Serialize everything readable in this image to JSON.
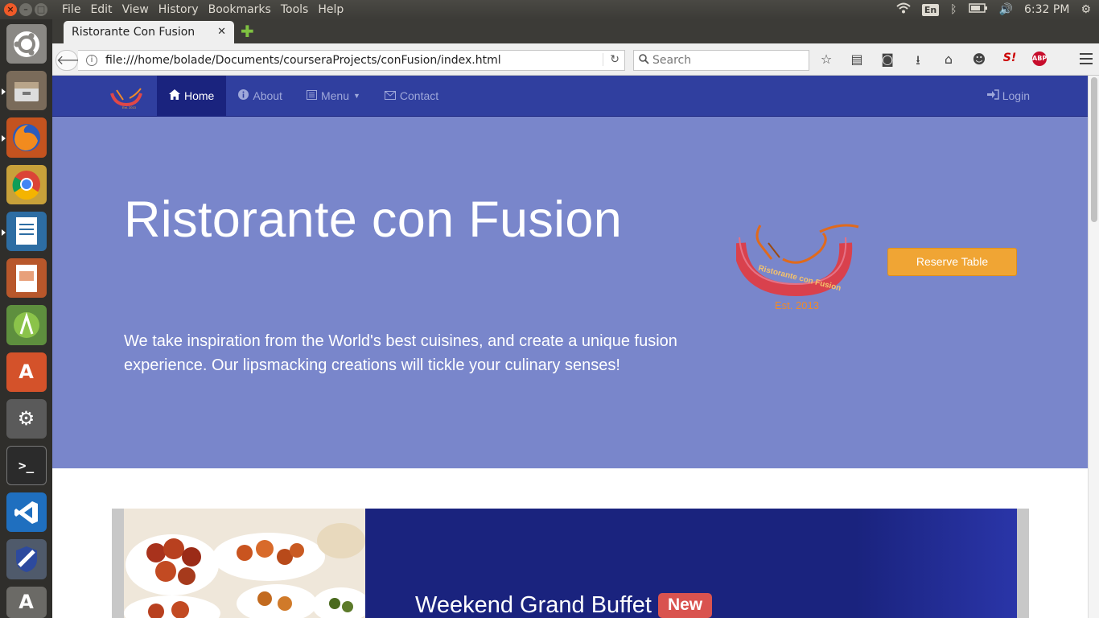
{
  "system": {
    "menu": [
      "File",
      "Edit",
      "View",
      "History",
      "Bookmarks",
      "Tools",
      "Help"
    ],
    "keyboard_layout": "En",
    "clock": "6:32 PM"
  },
  "browser": {
    "tab_title": "Ristorante Con Fusion",
    "url": "file:///home/bolade/Documents/courseraProjects/conFusion/index.html",
    "search_placeholder": "Search"
  },
  "site": {
    "nav": {
      "home": "Home",
      "about": "About",
      "menu": "Menu",
      "contact": "Contact",
      "login": "Login"
    },
    "jumbotron": {
      "title": "Ristorante con Fusion",
      "text": "We take inspiration from the World's best cuisines, and create a unique fusion experience. Our lipsmacking creations will tickle your culinary senses!",
      "reserve_button": "Reserve Table",
      "logo_text": "Ristorante con Fusion",
      "logo_est": "Est. 2013"
    },
    "carousel": {
      "title": "Weekend Grand Buffet",
      "badge": "New"
    }
  },
  "colors": {
    "nav_bg": "#303f9f",
    "nav_active": "#1a237e",
    "jumbotron_bg": "#7986cb",
    "reserve_button": "#f0a534",
    "badge": "#d9534f"
  }
}
